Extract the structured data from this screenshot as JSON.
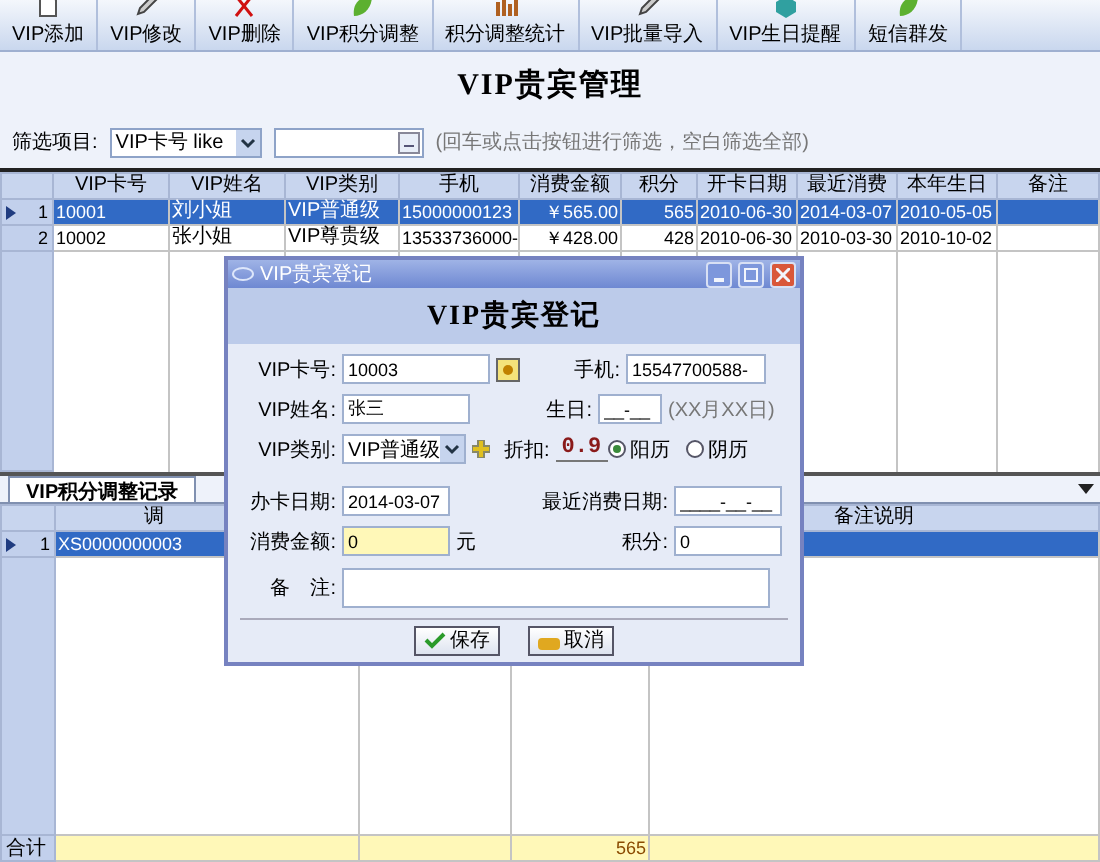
{
  "toolbar": [
    {
      "label": "VIP添加"
    },
    {
      "label": "VIP修改"
    },
    {
      "label": "VIP删除"
    },
    {
      "label": "VIP积分调整"
    },
    {
      "label": "积分调整统计"
    },
    {
      "label": "VIP批量导入"
    },
    {
      "label": "VIP生日提醒"
    },
    {
      "label": "短信群发"
    }
  ],
  "page_title": "VIP贵宾管理",
  "filter": {
    "label": "筛选项目:",
    "field": "VIP卡号 like",
    "hint": "(回车或点击按钮进行筛选，空白筛选全部)"
  },
  "members_table": {
    "columns": [
      "VIP卡号",
      "VIP姓名",
      "VIP类别",
      "手机",
      "消费金额",
      "积分",
      "开卡日期",
      "最近消费",
      "本年生日",
      "备注"
    ],
    "rows": [
      {
        "number": "1",
        "selected": true,
        "cells": [
          "10001",
          "刘小姐",
          "VIP普通级",
          "15000000123",
          "￥565.00",
          "565",
          "2010-06-30",
          "2014-03-07",
          "2010-05-05",
          ""
        ]
      },
      {
        "number": "2",
        "selected": false,
        "cells": [
          "10002",
          "张小姐",
          "VIP尊贵级",
          "13533736000-",
          "￥428.00",
          "428",
          "2010-06-30",
          "2010-03-30",
          "2010-10-02",
          ""
        ]
      }
    ]
  },
  "tabs": [
    {
      "label": "VIP积分调整记录",
      "selected": true
    }
  ],
  "records_table": {
    "column_1": "调",
    "column_4": "备注说明",
    "rows": [
      {
        "number": "1",
        "selected": true,
        "column_1": "XS0000000003"
      }
    ],
    "totals": {
      "label": "合计",
      "column_3": "565"
    }
  },
  "dialog": {
    "title": "VIP贵宾登记",
    "heading": "VIP贵宾登记",
    "card_no": {
      "label": "VIP卡号:",
      "value": "10003"
    },
    "phone": {
      "label": "手机:",
      "value": "15547700588-"
    },
    "name": {
      "label": "VIP姓名:",
      "value": "张三"
    },
    "birthday": {
      "label": "生日:",
      "value": "__-__",
      "hint": "(XX月XX日)"
    },
    "category": {
      "label": "VIP类别:",
      "value": "VIP普通级"
    },
    "discount": {
      "label": "折扣:",
      "value": "0.9"
    },
    "calendar": [
      {
        "label": "阳历",
        "selected": true
      },
      {
        "label": "阴历",
        "selected": false
      }
    ],
    "open_date": {
      "label": "办卡日期:",
      "value": "2014-03-07"
    },
    "last_date": {
      "label": "最近消费日期:",
      "value": "____-__-__"
    },
    "amount": {
      "label": "消费金额:",
      "value": "0",
      "unit": "元"
    },
    "points": {
      "label": "积分:",
      "value": "0"
    },
    "note": {
      "label": "备　注:"
    },
    "buttons": [
      {
        "label": "保存",
        "kind": "save"
      },
      {
        "label": "取消",
        "kind": "cancel"
      }
    ]
  }
}
